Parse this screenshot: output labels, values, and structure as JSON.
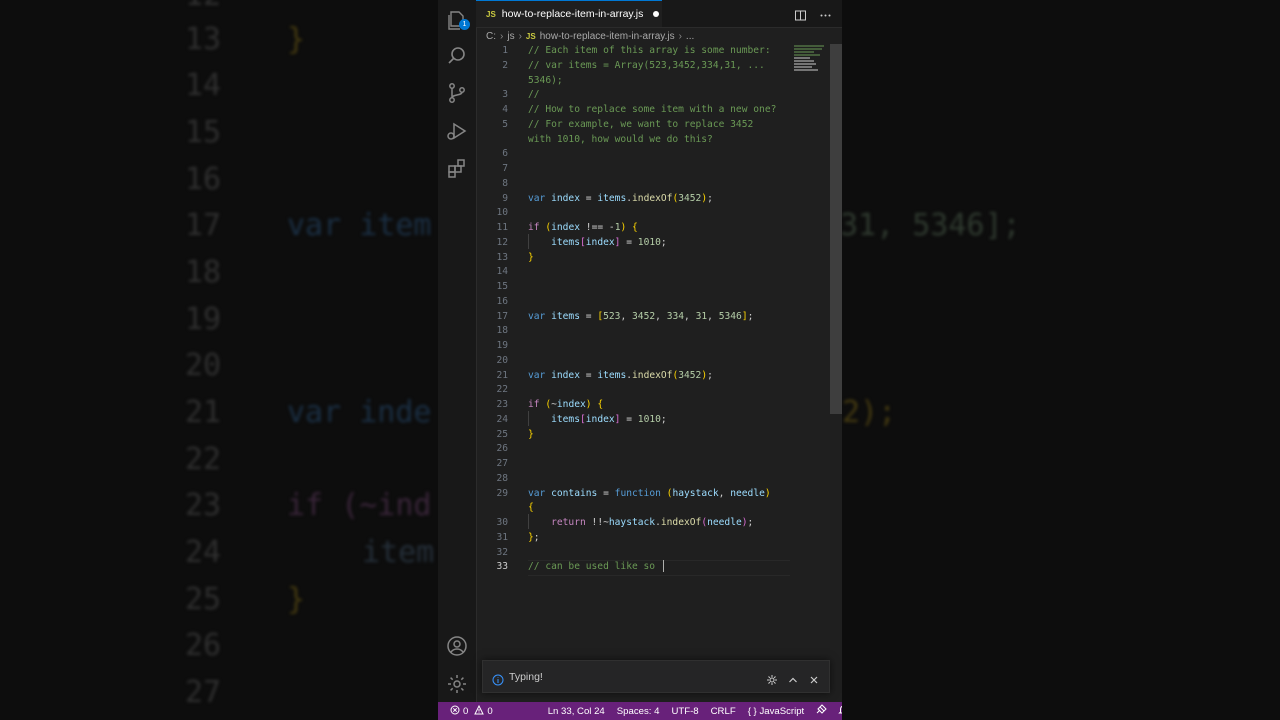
{
  "background_zoom": {
    "line_numbers": [
      "12",
      "13",
      "14",
      "15",
      "16",
      "17",
      "18",
      "19",
      "20",
      "21",
      "22",
      "23",
      "24",
      "25",
      "26",
      "27"
    ],
    "fragments": {
      "l13": "}",
      "l17a": "var item",
      "l17b": "31, 5346];",
      "l21a": "var inde",
      "l21b": "2);",
      "l23": "if (~ind",
      "l24": "item",
      "l25": "}"
    }
  },
  "tab": {
    "badge": "JS",
    "title": "how-to-replace-item-in-array.js"
  },
  "activity_badge": "1",
  "breadcrumb": {
    "items": [
      "C:",
      "js",
      "how-to-replace-item-in-array.js",
      "..."
    ],
    "badge": "JS"
  },
  "editor": {
    "active_line": 33,
    "lines": {
      "1": "1",
      "2": "2",
      "3": "3",
      "4": "4",
      "5": "5",
      "6": "6",
      "7": "7",
      "8": "8",
      "9": "9",
      "10": "10",
      "11": "11",
      "12": "12",
      "13": "13",
      "14": "14",
      "15": "15",
      "16": "16",
      "17": "17",
      "18": "18",
      "19": "19",
      "20": "20",
      "21": "21",
      "22": "22",
      "23": "23",
      "24": "24",
      "25": "25",
      "26": "26",
      "27": "27",
      "28": "28",
      "29": "29",
      "30": "30",
      "31": "31",
      "32": "32",
      "33": "33"
    },
    "code": {
      "c1": "// Each item of this array is some number:",
      "c2": "// var items = Array(523,3452,334,31, ...",
      "c2b": "5346);",
      "c3": "//",
      "c4": "// How to replace some item with a new one?",
      "c5": "// For example, we want to replace 3452",
      "c5b": "with 1010, how would we do this?",
      "c33": "// can be used like so "
    }
  },
  "notification": {
    "text": "Typing!"
  },
  "statusbar": {
    "errors": "0",
    "warnings": "0",
    "position": "Ln 33, Col 24",
    "spaces": "Spaces: 4",
    "encoding": "UTF-8",
    "eol": "CRLF",
    "language": "JavaScript",
    "language_icon": "{ }"
  }
}
